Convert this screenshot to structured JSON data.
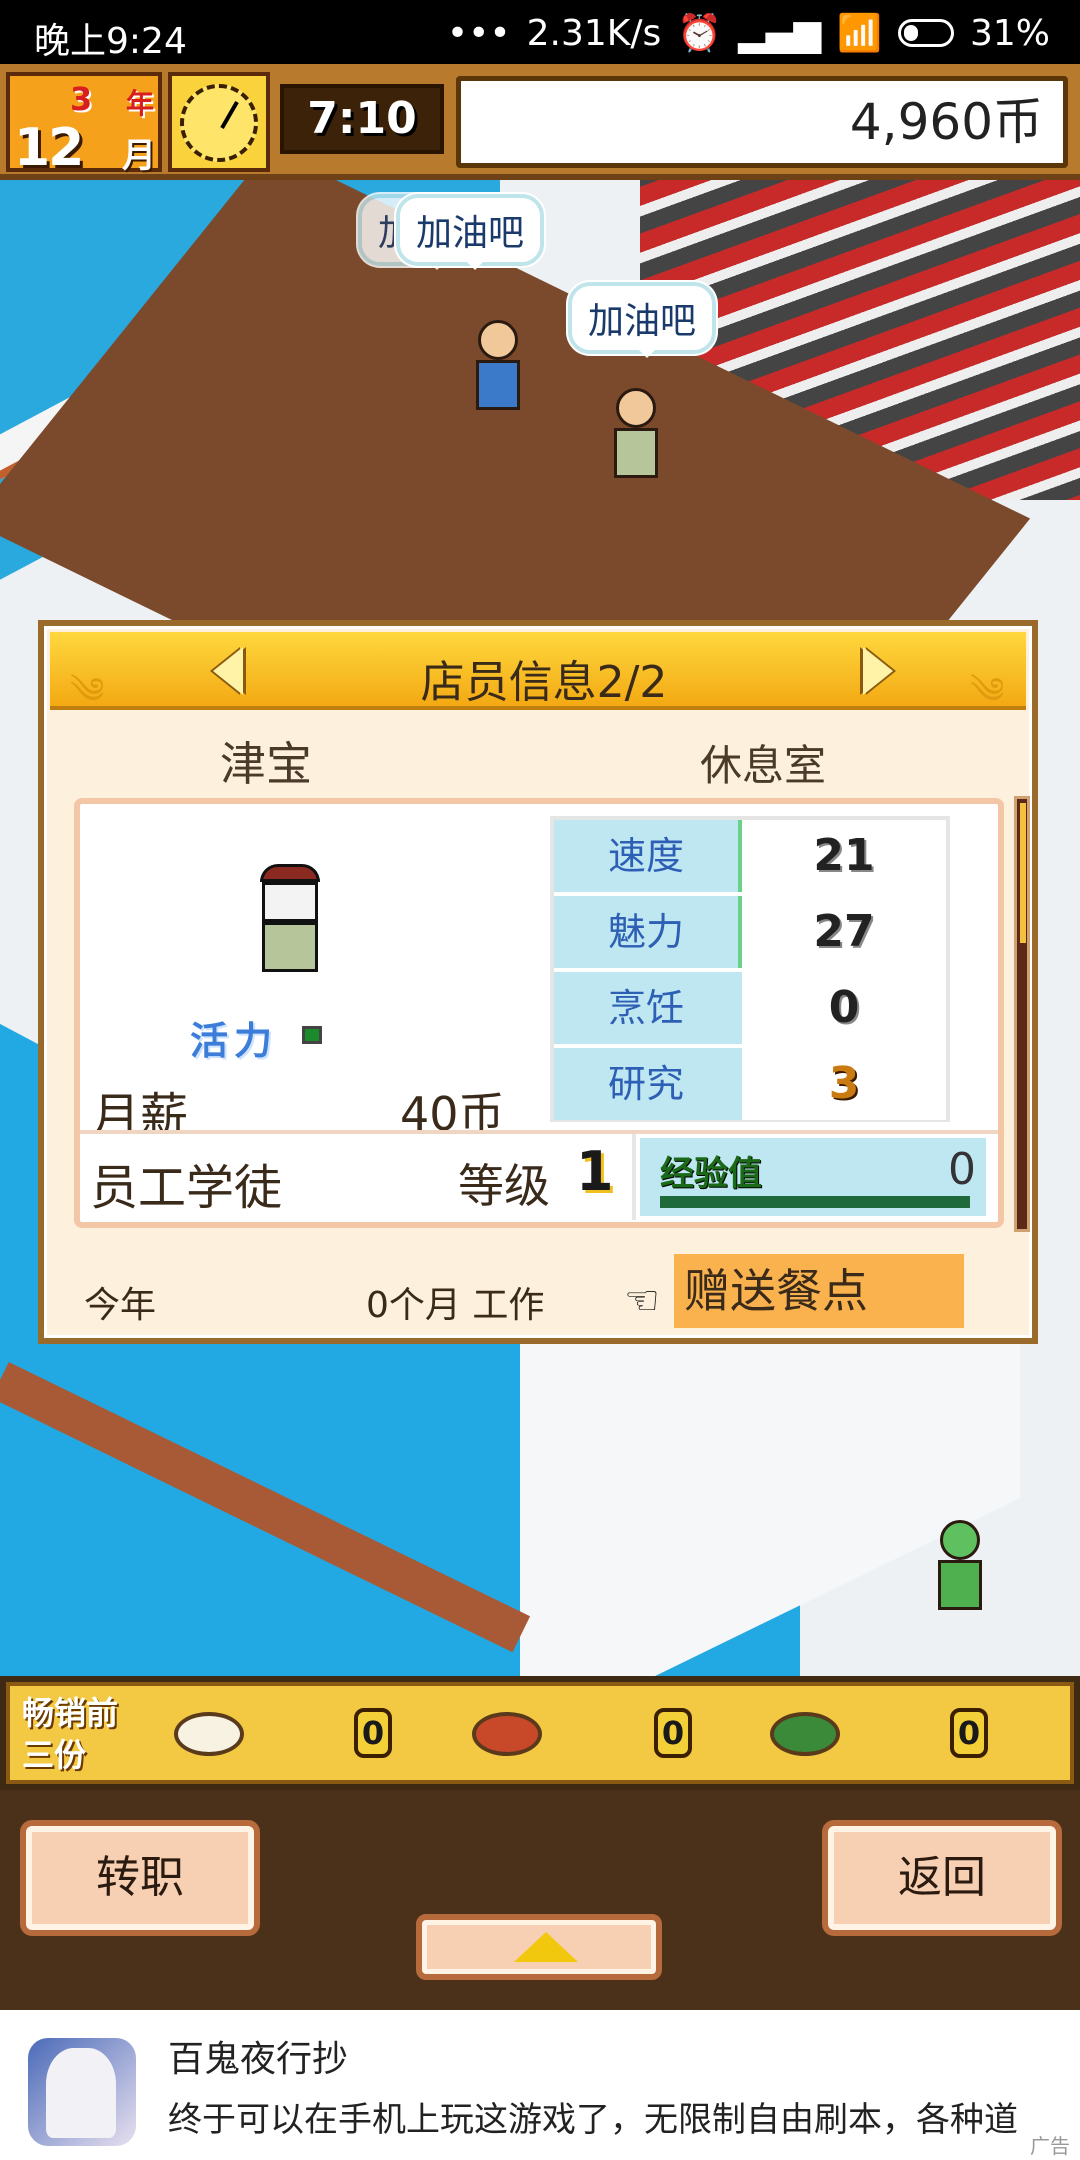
{
  "status_bar": {
    "time": "晚上9:24",
    "dots": "•••",
    "network_speed": "2.31K/s",
    "battery": "31%",
    "icons": [
      "alarm-icon",
      "signal-icon",
      "wifi-icon",
      "battery-icon"
    ]
  },
  "hud": {
    "year": "3",
    "year_unit": "年",
    "month": "12",
    "month_unit": "月",
    "time": "7:10",
    "money": "4,960币"
  },
  "scene": {
    "bubbles": [
      "加油吧",
      "加油吧",
      "加油吧"
    ]
  },
  "staff_panel": {
    "title": "店员信息2/2",
    "name": "津宝",
    "location": "休息室",
    "vitality_label": "活力",
    "salary_label": "月薪",
    "salary_value": "40币",
    "stats": [
      {
        "label": "速度",
        "value": "21"
      },
      {
        "label": "魅力",
        "value": "27"
      },
      {
        "label": "烹饪",
        "value": "0"
      },
      {
        "label": "研究",
        "value": "3"
      }
    ],
    "rank": "员工学徒",
    "level_label": "等级",
    "level_value": "1",
    "exp_label": "经验值",
    "exp_value": "0",
    "year_label": "今年",
    "work_label": "0个月 工作",
    "gift_button": "赠送餐点"
  },
  "best_sellers": {
    "label": "畅销前三份",
    "counts": [
      "0",
      "0",
      "0"
    ]
  },
  "bottom": {
    "transfer_button": "转职",
    "back_button": "返回"
  },
  "ad": {
    "title": "百鬼夜行抄",
    "description": "终于可以在手机上玩这游戏了，无限制自由刷本，各种道",
    "tag": "广告"
  }
}
